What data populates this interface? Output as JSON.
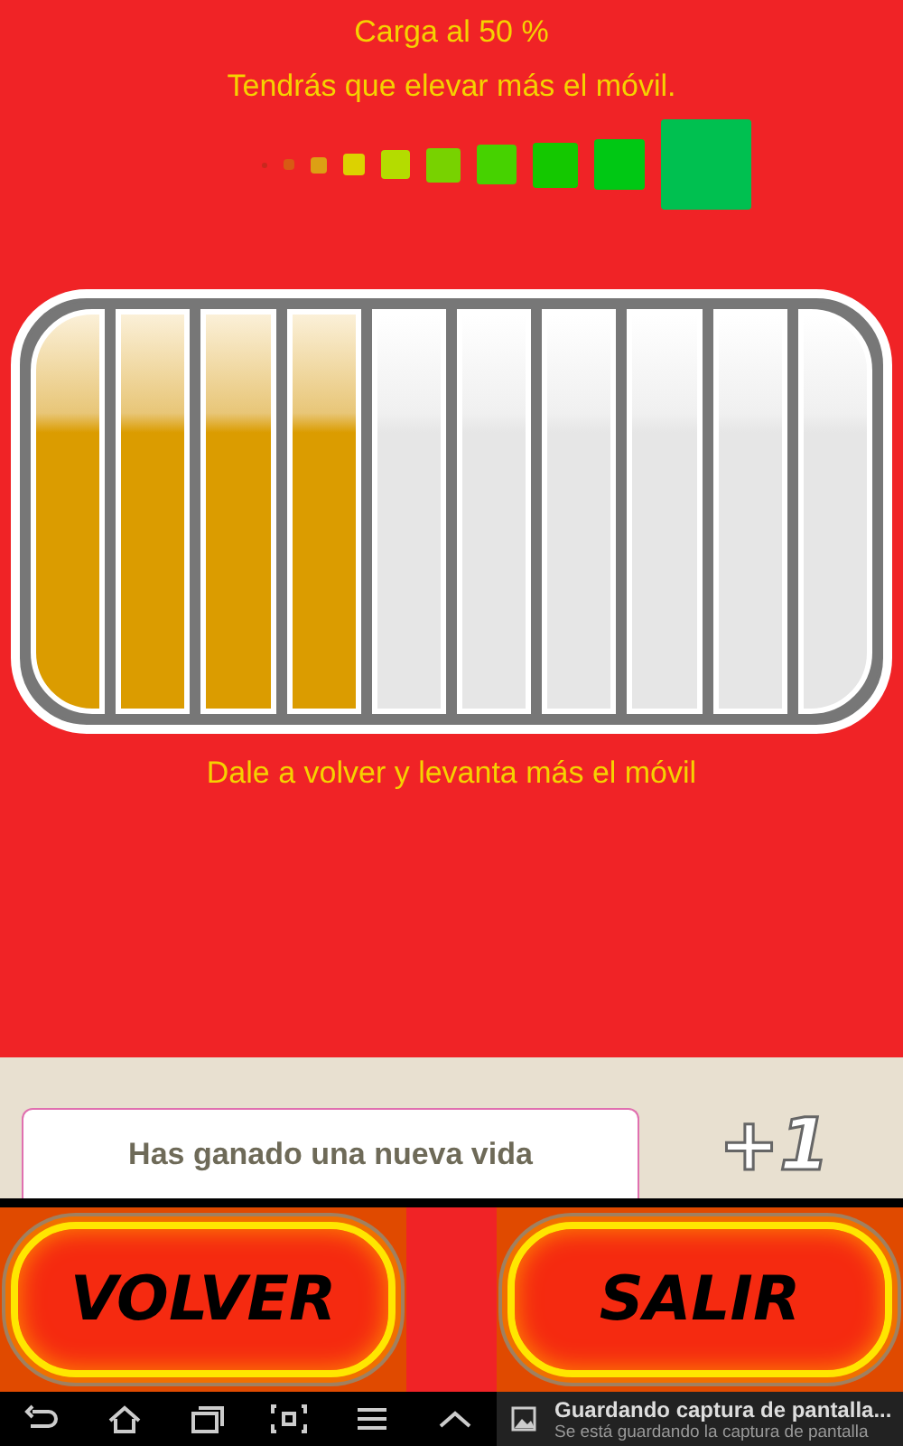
{
  "header": {
    "title": "Carga al 50 %",
    "message": "Tendrás que elevar más el móvil."
  },
  "signal_squares": [
    {
      "color": "#c8281e"
    },
    {
      "color": "#d85a14"
    },
    {
      "color": "#dca014"
    },
    {
      "color": "#dcd200"
    },
    {
      "color": "#b4dc00"
    },
    {
      "color": "#78d200"
    },
    {
      "color": "#46d200"
    },
    {
      "color": "#14c800"
    },
    {
      "color": "#00c814"
    },
    {
      "color": "#00c050"
    }
  ],
  "battery": {
    "segments": [
      {
        "filled": true
      },
      {
        "filled": true
      },
      {
        "filled": true
      },
      {
        "filled": true
      },
      {
        "filled": false
      },
      {
        "filled": false
      },
      {
        "filled": false
      },
      {
        "filled": false
      },
      {
        "filled": false
      },
      {
        "filled": false
      }
    ]
  },
  "hint": "Dale a volver y levanta más el móvil",
  "reward": {
    "message": "Has ganado una nueva vida",
    "badge": "+1"
  },
  "buttons": [
    {
      "label": "VOLVER"
    },
    {
      "label": "SALIR"
    }
  ],
  "notification": {
    "title": "Guardando captura de pantalla...",
    "text": "Se está guardando la captura de pantalla"
  }
}
